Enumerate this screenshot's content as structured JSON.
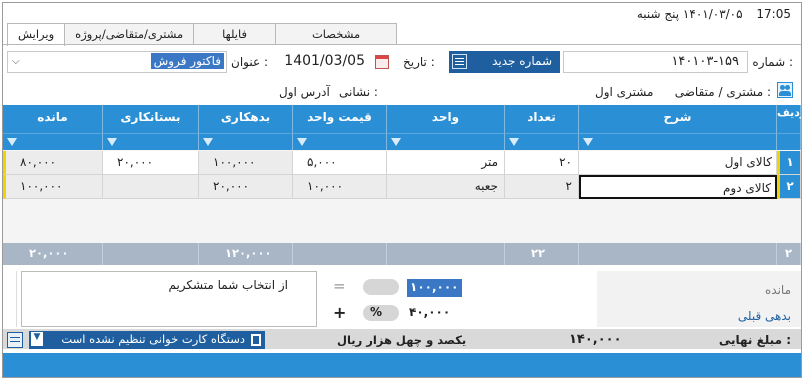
{
  "header": {
    "time": "17:05",
    "date_line": "۱۴۰۱/۰۳/۰۵  پنج شنبه"
  },
  "tabs": [
    {
      "label": "ویرایش",
      "active": true
    },
    {
      "label": "مشتری/متقاضی/پروژه",
      "active": false
    },
    {
      "label": "فایلها",
      "active": false
    },
    {
      "label": "مشخصات",
      "active": false
    }
  ],
  "form": {
    "number_label": "شماره :",
    "number_value": "۱۴۰۱۰۳-۱۵۹",
    "new_number_button": "شماره جدید",
    "date_label": "تاریخ :",
    "date_value": "1401/03/05",
    "title_label": "عنوان :",
    "title_value": "فاکتور فروش",
    "customer_label": "مشتری / متقاضی :",
    "customer_value": "مشتری اول",
    "address_label": "نشانی :",
    "address_value": "آدرس اول"
  },
  "grid": {
    "columns": [
      "ردیف",
      "شرح",
      "تعداد",
      "واحد",
      "قیمت واحد",
      "بدهکاری",
      "بستانکاری",
      "مانده"
    ],
    "rows": [
      {
        "rn": "۱",
        "desc": "کالای اول",
        "qty": "۲۰",
        "unit": "متر",
        "price": "۵,۰۰۰",
        "debit": "۱۰۰,۰۰۰",
        "credit": "۲۰,۰۰۰",
        "balance": "۸۰,۰۰۰"
      },
      {
        "rn": "۲",
        "desc": "کالای دوم",
        "qty": "۲",
        "unit": "جعبه",
        "price": "۱۰,۰۰۰",
        "debit": "۲۰,۰۰۰",
        "credit": "",
        "balance": "۱۰۰,۰۰۰"
      }
    ],
    "footer": {
      "count": "۲",
      "qty_total": "۲۲",
      "debit_total": "۱۲۰,۰۰۰",
      "credit_total": "۲۰,۰۰۰"
    }
  },
  "bottom": {
    "note_text": "از انتخاب شما متشکریم",
    "balance_label": "مانده",
    "prev_debt_label": "بدهی قبلی",
    "amount_selected": "۱۰۰,۰۰۰",
    "amount_second": "۴۰,۰۰۰",
    "equals_sign": "=",
    "percent_sign": "%",
    "plus_sign": "+",
    "final_label": "مبلغ نهایی :",
    "final_value": "۱۴۰,۰۰۰",
    "final_words": "یکصد و چهل هزار  ریال",
    "card_reader_status": "دستگاه کارت خوانی تنظیم نشده است"
  },
  "colors": {
    "grid_header": "#2a8fd4",
    "footer_row": "#a9b6c6",
    "selection": "#3a78c6",
    "accent_yellow": "#f3d200"
  },
  "icons": [
    "calendar-icon",
    "list-icon",
    "group-icon",
    "card-reader-icon",
    "settings-icon",
    "chevron-down-icon",
    "filter-icon"
  ]
}
